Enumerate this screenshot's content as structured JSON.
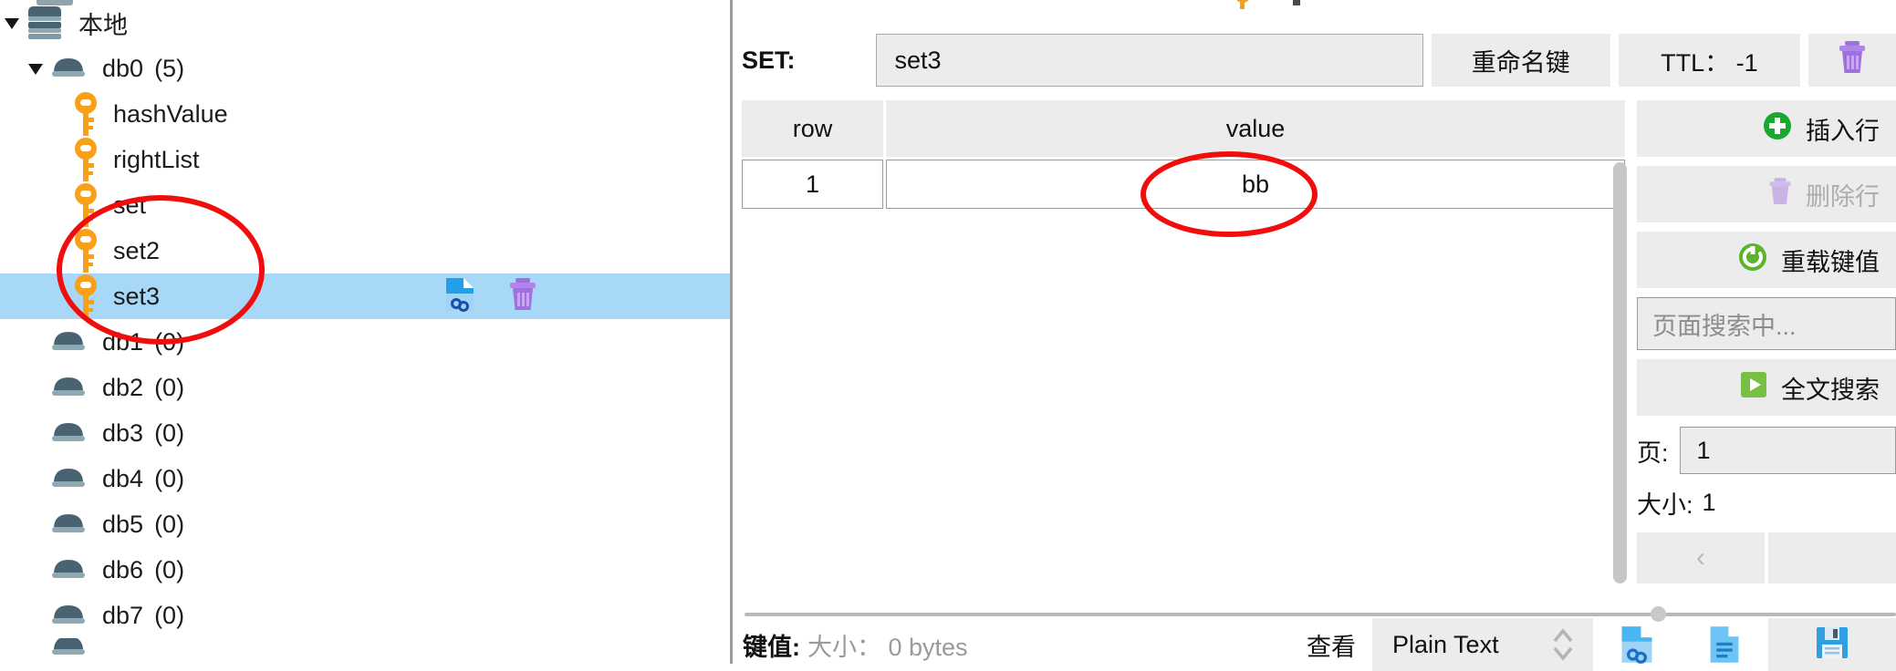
{
  "sidebar": {
    "items": [
      {
        "label": "本地",
        "count": "",
        "type": "server",
        "indent": 0,
        "expanded": true,
        "selected": false,
        "icon": "server-stack-icon"
      },
      {
        "label": "db0",
        "count": "(5)",
        "type": "db",
        "indent": 1,
        "expanded": true,
        "selected": false,
        "icon": "database-icon"
      },
      {
        "label": "hashValue",
        "count": "",
        "type": "key",
        "indent": 2,
        "expanded": false,
        "selected": false,
        "icon": "key-icon"
      },
      {
        "label": "rightList",
        "count": "",
        "type": "key",
        "indent": 2,
        "expanded": false,
        "selected": false,
        "icon": "key-icon"
      },
      {
        "label": "set",
        "count": "",
        "type": "key",
        "indent": 2,
        "expanded": false,
        "selected": false,
        "icon": "key-icon"
      },
      {
        "label": "set2",
        "count": "",
        "type": "key",
        "indent": 2,
        "expanded": false,
        "selected": false,
        "icon": "key-icon"
      },
      {
        "label": "set3",
        "count": "",
        "type": "key",
        "indent": 2,
        "expanded": false,
        "selected": true,
        "icon": "key-icon"
      },
      {
        "label": "db1",
        "count": "(0)",
        "type": "db",
        "indent": 1,
        "expanded": false,
        "selected": false,
        "icon": "database-icon"
      },
      {
        "label": "db2",
        "count": "(0)",
        "type": "db",
        "indent": 1,
        "expanded": false,
        "selected": false,
        "icon": "database-icon"
      },
      {
        "label": "db3",
        "count": "(0)",
        "type": "db",
        "indent": 1,
        "expanded": false,
        "selected": false,
        "icon": "database-icon"
      },
      {
        "label": "db4",
        "count": "(0)",
        "type": "db",
        "indent": 1,
        "expanded": false,
        "selected": false,
        "icon": "database-icon"
      },
      {
        "label": "db5",
        "count": "(0)",
        "type": "db",
        "indent": 1,
        "expanded": false,
        "selected": false,
        "icon": "database-icon"
      },
      {
        "label": "db6",
        "count": "(0)",
        "type": "db",
        "indent": 1,
        "expanded": false,
        "selected": false,
        "icon": "database-icon"
      },
      {
        "label": "db7",
        "count": "(0)",
        "type": "db",
        "indent": 1,
        "expanded": false,
        "selected": false,
        "icon": "database-icon"
      }
    ],
    "selected_row_actions": [
      "copy-key-icon",
      "delete-key-icon"
    ]
  },
  "detail": {
    "key_type_label": "SET:",
    "key_name": "set3",
    "rename_label": "重命名键",
    "ttl_label": "TTL： -1",
    "delete_icon": "trash-icon"
  },
  "table": {
    "columns": [
      "row",
      "value"
    ],
    "rows": [
      {
        "row": "1",
        "value": "bb"
      }
    ]
  },
  "tools": {
    "insert_row": "插入行",
    "delete_row": "删除行",
    "reload_value": "重载键值",
    "page_search_placeholder": "页面搜索中...",
    "full_text_search": "全文搜索",
    "page_label": "页:",
    "page_value": "1",
    "size_label": "大小:",
    "size_value": "1",
    "prev_page": "‹",
    "next_page": ""
  },
  "status": {
    "key_value_label": "键值:",
    "size_text": "大小： 0 bytes",
    "view_label": "查看",
    "view_format": "Plain Text",
    "icons": [
      "copy-link-icon",
      "document-icon",
      "save-icon"
    ]
  },
  "colors": {
    "selection": "#a8d8f8",
    "key_icon": "#f9a01b",
    "db_icon": "#3f5a6b",
    "annotation": "#f20d0d",
    "accent_green": "#3bab2c",
    "trash_purple": "#a06fe0"
  }
}
